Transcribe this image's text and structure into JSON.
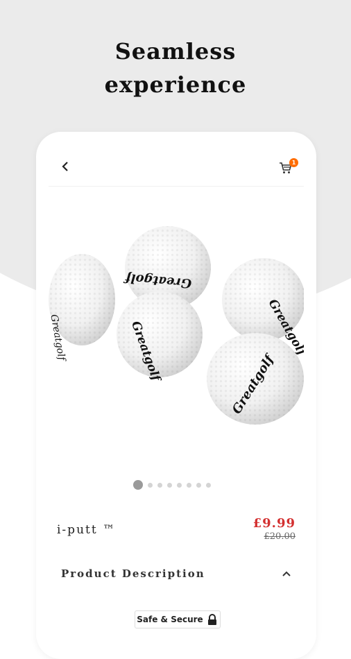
{
  "headline": {
    "line1": "Seamless",
    "line2": "experience"
  },
  "topbar": {
    "back_icon": "chevron-left-icon",
    "cart_icon": "shopping-cart-icon",
    "cart_badge": "1"
  },
  "product": {
    "name": "i-putt ™",
    "price_current": "£9.99",
    "price_old": "£20.00",
    "image_brand_text": "Greatgolf",
    "carousel": {
      "total": 8,
      "active_index": 0
    }
  },
  "description": {
    "label": "Product Description",
    "icon": "chevron-up-icon"
  },
  "badge": {
    "label": "Safe & Secure",
    "icon": "lock-icon"
  },
  "colors": {
    "background_gray": "#ebebeb",
    "price_red": "#d32f2f",
    "badge_orange": "#ff6d00"
  }
}
